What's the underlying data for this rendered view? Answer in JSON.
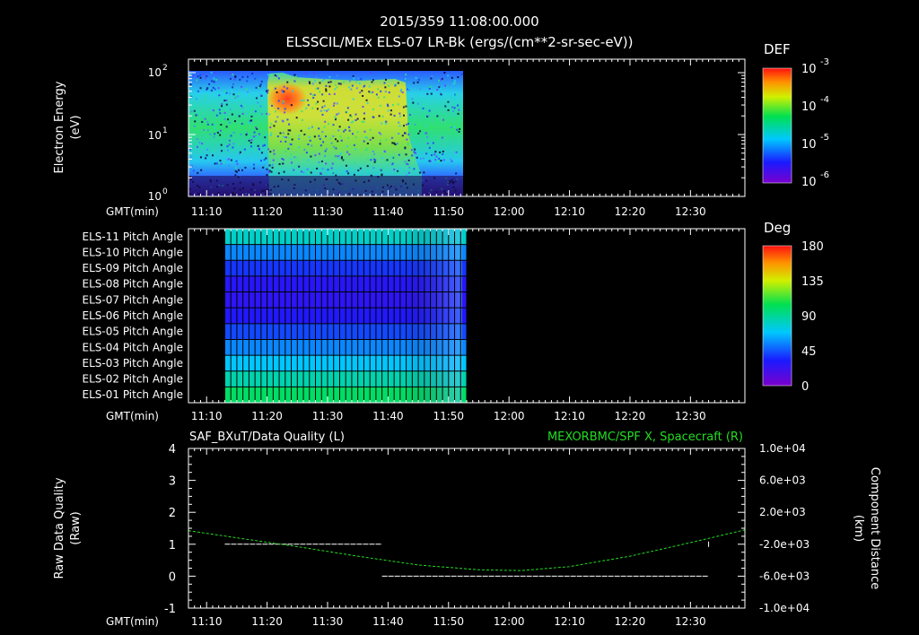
{
  "header": {
    "timestamp": "2015/359 11:08:00.000",
    "subtitle": "ELSSCIL/MEx ELS-07 LR-Bk  (ergs/(cm**2-sr-sec-eV))"
  },
  "time_axis": {
    "label": "GMT(min)",
    "ticks": [
      "11:10",
      "11:20",
      "11:30",
      "11:40",
      "11:50",
      "12:00",
      "12:10",
      "12:20",
      "12:30"
    ]
  },
  "panel1": {
    "ylabel_line1": "Electron Energy",
    "ylabel_line2": "(eV)",
    "yticks": [
      {
        "base": "10",
        "exp": "2"
      },
      {
        "base": "10",
        "exp": "1"
      },
      {
        "base": "10",
        "exp": "0"
      }
    ],
    "colorbar": {
      "title": "DEF",
      "ticks": [
        {
          "base": "10",
          "exp": "-3"
        },
        {
          "base": "10",
          "exp": "-4"
        },
        {
          "base": "10",
          "exp": "-5"
        },
        {
          "base": "10",
          "exp": "-6"
        }
      ]
    }
  },
  "panel2": {
    "rows": [
      "ELS-11 Pitch Angle",
      "ELS-10 Pitch Angle",
      "ELS-09 Pitch Angle",
      "ELS-08 Pitch Angle",
      "ELS-07 Pitch Angle",
      "ELS-06 Pitch Angle",
      "ELS-05 Pitch Angle",
      "ELS-04 Pitch Angle",
      "ELS-03 Pitch Angle",
      "ELS-02 Pitch Angle",
      "ELS-01 Pitch Angle"
    ],
    "colorbar": {
      "title": "Deg",
      "ticks": [
        "180",
        "135",
        "90",
        "45",
        "0"
      ]
    }
  },
  "panel3": {
    "title_left": "SAF_BXuT/Data Quality (L)",
    "title_right": "MEXORBMC/SPF X, Spacecraft (R)",
    "ylabel_left_line1": "Raw Data Quality",
    "ylabel_left_line2": "(Raw)",
    "ylabel_right_line1": "Component Distance",
    "ylabel_right_line2": "(km)",
    "left_ticks": [
      "4",
      "3",
      "2",
      "1",
      "0",
      "-1"
    ],
    "right_ticks": [
      "1.0e+04",
      "6.0e+03",
      "2.0e+03",
      "-2.0e+03",
      "-6.0e+03",
      "-1.0e+04"
    ]
  },
  "chart_data": [
    {
      "type": "heatmap",
      "title": "ELSSCIL/MEx ELS-07 LR-Bk  (ergs/(cm**2-sr-sec-eV))",
      "ylabel": "Electron Energy (eV)",
      "yscale": "log",
      "ylim": [
        1,
        150
      ],
      "xlim": [
        "11:07",
        "12:39"
      ],
      "data_extent_time": [
        "11:07",
        "11:53"
      ],
      "color_scale": "log",
      "clim": [
        1e-06,
        0.001
      ],
      "colorbar_label": "DEF",
      "enhancement_time": [
        "11:20",
        "11:46"
      ]
    },
    {
      "type": "heatmap",
      "title": "ELS Pitch Angle",
      "categories": [
        "ELS-11",
        "ELS-10",
        "ELS-09",
        "ELS-08",
        "ELS-07",
        "ELS-06",
        "ELS-05",
        "ELS-04",
        "ELS-03",
        "ELS-02",
        "ELS-01"
      ],
      "row_values_deg": [
        80,
        55,
        38,
        28,
        26,
        30,
        42,
        55,
        68,
        85,
        100
      ],
      "data_extent_time": [
        "11:13",
        "11:53"
      ],
      "clim": [
        0,
        180
      ],
      "colorbar_label": "Deg"
    },
    {
      "type": "line",
      "title": "SAF_BXuT/Data Quality (L) / MEXORBMC/SPF X, Spacecraft (R)",
      "series": [
        {
          "name": "SAF_BXuT/Data Quality",
          "axis": "left",
          "color": "#ffffff",
          "segments": [
            {
              "x": [
                "11:13",
                "11:39"
              ],
              "y": [
                1,
                1
              ]
            },
            {
              "x": [
                "11:39",
                "12:33"
              ],
              "y": [
                0,
                0
              ]
            },
            {
              "x": [
                "12:33",
                "12:33"
              ],
              "y": [
                1,
                1
              ]
            }
          ]
        },
        {
          "name": "MEXORBMC/SPF X, Spacecraft",
          "axis": "right",
          "color": "#22dd22",
          "x": [
            "11:07",
            "11:15",
            "11:25",
            "11:35",
            "11:45",
            "11:55",
            "12:02",
            "12:10",
            "12:20",
            "12:30",
            "12:39"
          ],
          "y": [
            -300,
            -1200,
            -2300,
            -3500,
            -4600,
            -5200,
            -5300,
            -4800,
            -3500,
            -1800,
            -200
          ]
        }
      ],
      "ylim_left": [
        -1,
        4
      ],
      "ylim_right": [
        -10000,
        10000
      ]
    }
  ]
}
